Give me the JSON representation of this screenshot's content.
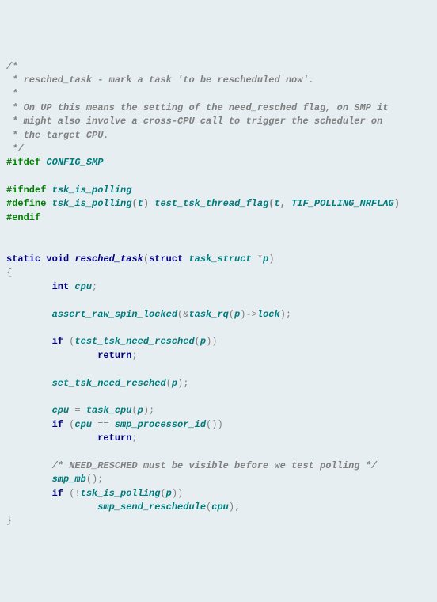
{
  "code": {
    "c1": "/*",
    "c2": " * resched_task - mark a task 'to be rescheduled now'.",
    "c3": " *",
    "c4": " * On UP this means the setting of the need_resched flag, on SMP it",
    "c5": " * might also involve a cross-CPU call to trigger the scheduler on",
    "c6": " * the target CPU.",
    "c7": " */",
    "p1": "#ifdef",
    "p1b": "CONFIG_SMP",
    "p2": "#ifndef",
    "p2b": "tsk_is_polling",
    "p3": "#define",
    "p3b": "tsk_is_polling",
    "p3c": "t",
    "p3d": "test_tsk_thread_flag",
    "p3e": "t",
    "p3f": "TIF_POLLING_NRFLAG",
    "p4": "#endif",
    "k_static": "static",
    "k_void": "void",
    "fn_name": "resched_task",
    "k_struct": "struct",
    "t_task_struct": "task_struct",
    "arg_p": "p",
    "k_int": "int",
    "v_cpu": "cpu",
    "fn_assert": "assert_raw_spin_locked",
    "fn_task_rq": "task_rq",
    "fld_lock": "lock",
    "k_if": "if",
    "fn_test": "test_tsk_need_resched",
    "k_return": "return",
    "fn_set": "set_tsk_need_resched",
    "fn_task_cpu": "task_cpu",
    "fn_smp_pid": "smp_processor_id",
    "c8": "/* NEED_RESCHED must be visible before we test polling */",
    "fn_smp_mb": "smp_mb",
    "fn_poll": "tsk_is_polling",
    "fn_smp_resched": "smp_send_reschedule"
  }
}
